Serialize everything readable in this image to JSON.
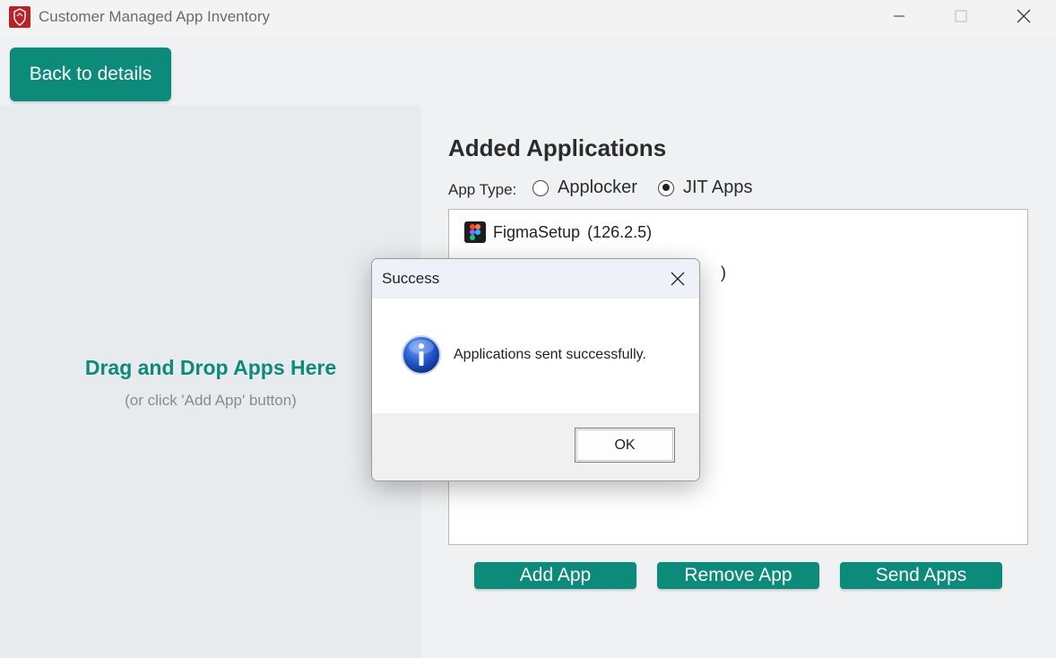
{
  "window": {
    "title": "Customer Managed App Inventory",
    "icon": "shield-icon"
  },
  "toolbar": {
    "back_label": "Back to details"
  },
  "drop_zone": {
    "title": "Drag and Drop Apps Here",
    "subtitle": "(or click 'Add App' button)"
  },
  "section": {
    "title": "Added Applications"
  },
  "app_type": {
    "label": "App Type:",
    "options": [
      {
        "label": "Applocker",
        "checked": false
      },
      {
        "label": "JIT Apps",
        "checked": true
      }
    ]
  },
  "app_list": {
    "items": [
      {
        "name": "FigmaSetup",
        "version": "(126.2.5)",
        "icon": "figma-icon"
      },
      {
        "name": "",
        "version": ")",
        "icon": ""
      }
    ]
  },
  "actions": {
    "add_label": "Add App",
    "remove_label": "Remove App",
    "send_label": "Send Apps"
  },
  "dialog": {
    "title": "Success",
    "message": "Applications sent successfully.",
    "ok_label": "OK",
    "icon": "info-icon"
  },
  "colors": {
    "accent": "#0c8a7a",
    "app_icon_red": "#b8232a"
  }
}
